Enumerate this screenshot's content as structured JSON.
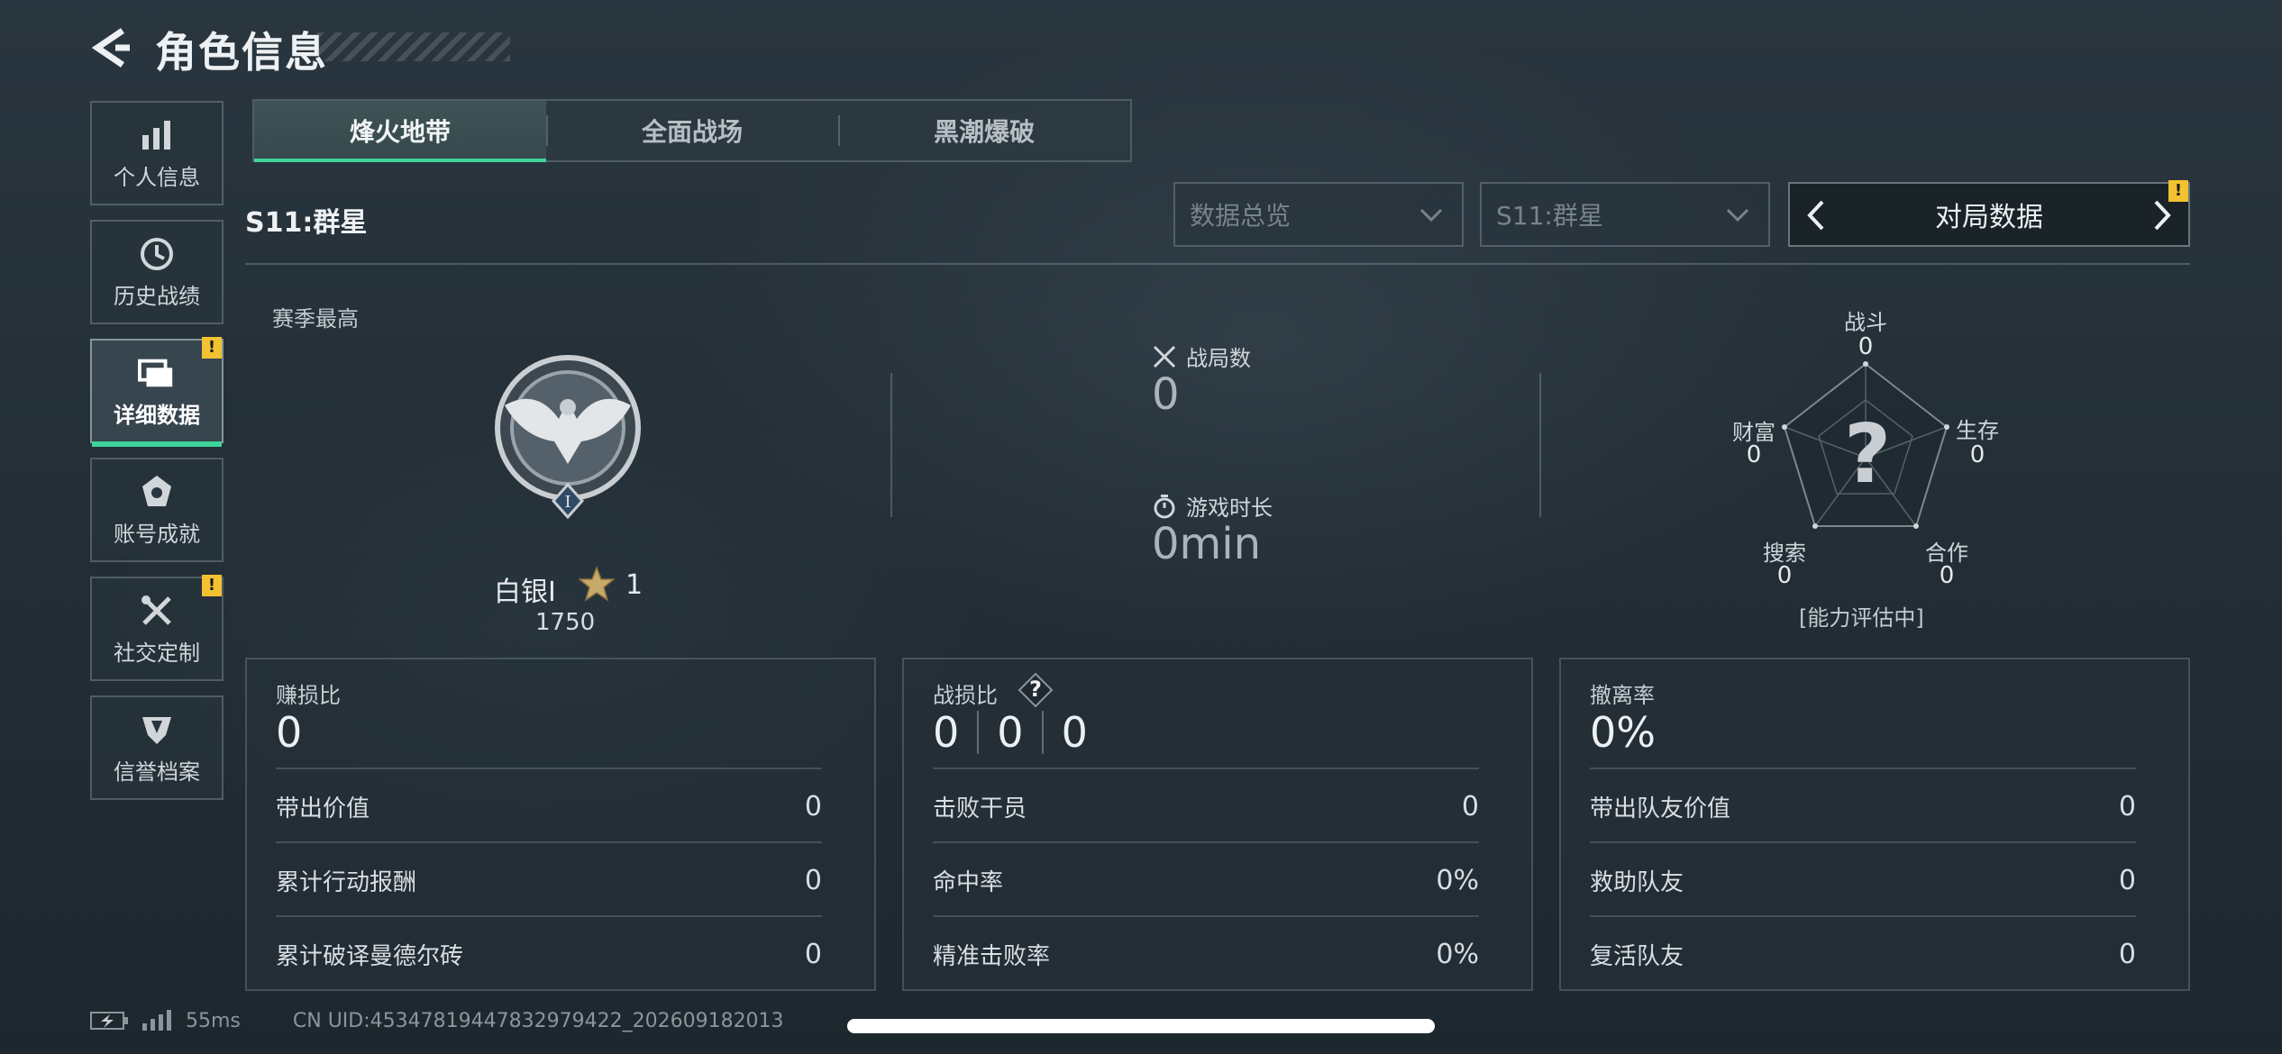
{
  "header": {
    "title": "角色信息"
  },
  "nav": [
    {
      "label": "个人信息",
      "icon": "bar-chart-icon",
      "active": false,
      "badge": ""
    },
    {
      "label": "历史战绩",
      "icon": "clock-icon",
      "active": false,
      "badge": ""
    },
    {
      "label": "详细数据",
      "icon": "folders-icon",
      "active": true,
      "badge": "!"
    },
    {
      "label": "账号成就",
      "icon": "medal-icon",
      "active": false,
      "badge": ""
    },
    {
      "label": "社交定制",
      "icon": "tools-icon",
      "active": false,
      "badge": "!"
    },
    {
      "label": "信誉档案",
      "icon": "shield-icon",
      "active": false,
      "badge": ""
    }
  ],
  "tabs": [
    "烽火地带",
    "全面战场",
    "黑潮爆破"
  ],
  "season": "S11:群星",
  "filters": {
    "overview": "数据总览",
    "season": "S11:群星",
    "pager_label": "对局数据",
    "pager_badge": "!"
  },
  "overview": {
    "season_best_label": "赛季最高",
    "rank_name": "白银I",
    "rank_stars": "1",
    "rank_score": "1750",
    "matches_label": "战局数",
    "matches_value": "0",
    "playtime_label": "游戏时长",
    "playtime_value": "0min"
  },
  "radar": {
    "center": "?",
    "status": "[能力评估中]",
    "axes": [
      {
        "label": "战斗",
        "value": "0"
      },
      {
        "label": "生存",
        "value": "0"
      },
      {
        "label": "合作",
        "value": "0"
      },
      {
        "label": "搜索",
        "value": "0"
      },
      {
        "label": "财富",
        "value": "0"
      }
    ]
  },
  "cards": [
    {
      "title": "赚损比",
      "big": "0",
      "rows": [
        {
          "label": "带出价值",
          "value": "0"
        },
        {
          "label": "累计行动报酬",
          "value": "0"
        },
        {
          "label": "累计破译曼德尔砖",
          "value": "0"
        }
      ]
    },
    {
      "title": "战损比",
      "help": "?",
      "kd": [
        "0",
        "0",
        "0"
      ],
      "rows": [
        {
          "label": "击败干员",
          "value": "0"
        },
        {
          "label": "命中率",
          "value": "0%"
        },
        {
          "label": "精准击败率",
          "value": "0%"
        }
      ]
    },
    {
      "title": "撤离率",
      "big": "0%",
      "rows": [
        {
          "label": "带出队友价值",
          "value": "0"
        },
        {
          "label": "救助队友",
          "value": "0"
        },
        {
          "label": "复活队友",
          "value": "0"
        }
      ]
    }
  ],
  "footer": {
    "ping": "55ms",
    "uid": "CN UID:4534781944783297942​2_202609182013"
  }
}
